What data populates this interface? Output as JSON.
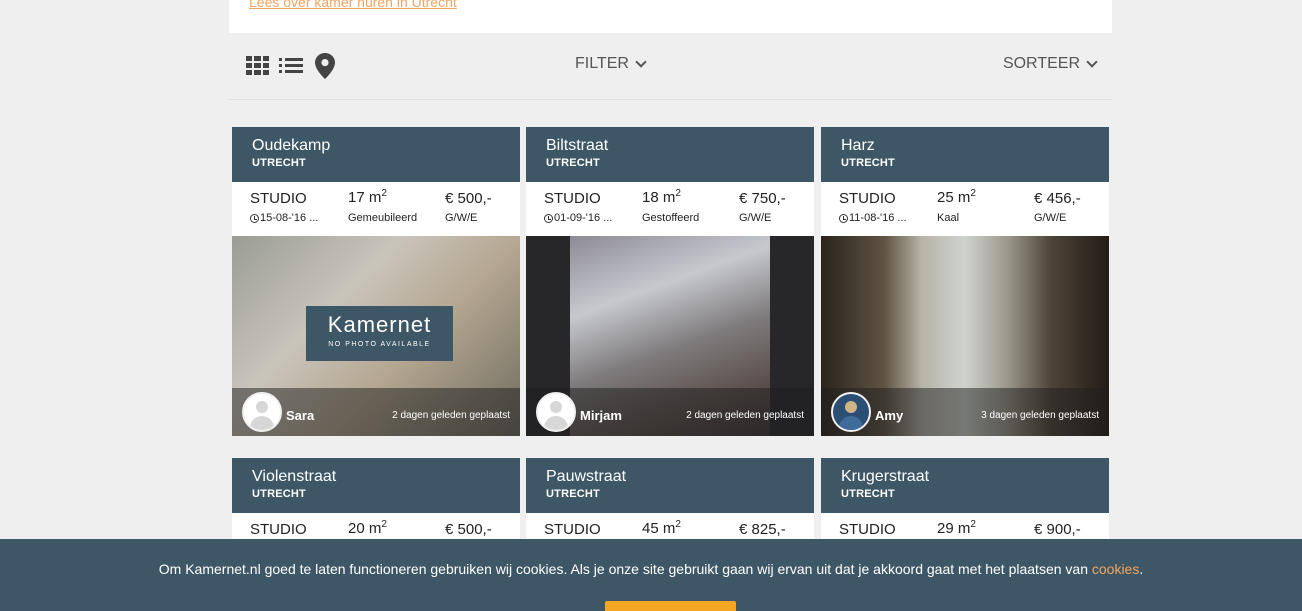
{
  "top": {
    "link": "Lees over kamer huren in Utrecht"
  },
  "toolbar": {
    "filter": "FILTER",
    "sort": "SORTEER"
  },
  "colors": {
    "header": "#3e5766",
    "accent": "#f4a460",
    "button": "#f5a623"
  },
  "listings": [
    {
      "street": "Oudekamp",
      "city": "UTRECHT",
      "type": "STUDIO",
      "size": "17 m",
      "size_unit": "2",
      "price": "€ 500,-",
      "date": "15-08-'16 ...",
      "furnishing": "Gemeubileerd",
      "utilities": "G/W/E",
      "owner": "Sara",
      "posted": "2 dagen geleden geplaatst",
      "brand": "Kamernet",
      "brand_sub": "NO PHOTO AVAILABLE"
    },
    {
      "street": "Biltstraat",
      "city": "UTRECHT",
      "type": "STUDIO",
      "size": "18 m",
      "size_unit": "2",
      "price": "€ 750,-",
      "date": "01-09-'16 ...",
      "furnishing": "Gestoffeerd",
      "utilities": "G/W/E",
      "owner": "Mirjam",
      "posted": "2 dagen geleden geplaatst"
    },
    {
      "street": "Harz",
      "city": "UTRECHT",
      "type": "STUDIO",
      "size": "25 m",
      "size_unit": "2",
      "price": "€ 456,-",
      "date": "11-08-'16 ...",
      "furnishing": "Kaal",
      "utilities": "G/W/E",
      "owner": "Amy",
      "posted": "3 dagen geleden geplaatst"
    },
    {
      "street": "Violenstraat",
      "city": "UTRECHT",
      "type": "STUDIO",
      "size": "20 m",
      "size_unit": "2",
      "price": "€ 500,-"
    },
    {
      "street": "Pauwstraat",
      "city": "UTRECHT",
      "type": "STUDIO",
      "size": "45 m",
      "size_unit": "2",
      "price": "€ 825,-"
    },
    {
      "street": "Krugerstraat",
      "city": "UTRECHT",
      "type": "STUDIO",
      "size": "29 m",
      "size_unit": "2",
      "price": "€ 900,-"
    }
  ],
  "cookie": {
    "text": "Om Kamernet.nl goed te laten functioneren gebruiken wij cookies. Als je onze site gebruikt gaan wij ervan uit dat je akkoord gaat met het plaatsen van ",
    "link": "cookies",
    "end": "."
  }
}
